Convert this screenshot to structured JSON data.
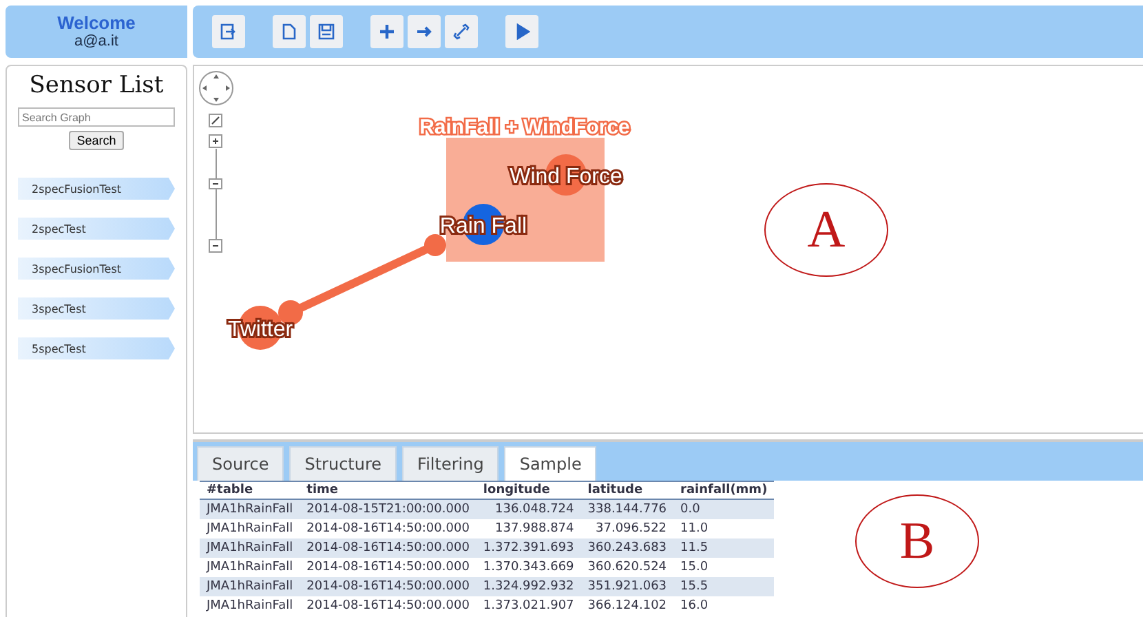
{
  "welcome": {
    "title": "Welcome",
    "user": "a@a.it"
  },
  "sidebar": {
    "title": "Sensor List",
    "search": {
      "placeholder": "Search Graph"
    },
    "search_button": "Search",
    "items": [
      {
        "label": "2specFusionTest"
      },
      {
        "label": "2specTest"
      },
      {
        "label": "3specFusionTest"
      },
      {
        "label": "3specTest"
      },
      {
        "label": "5specTest"
      }
    ]
  },
  "graph": {
    "group_label": "RainFall + WindForce",
    "nodes": [
      {
        "label": "Wind Force",
        "color": "#f26b47"
      },
      {
        "label": "Rain Fall",
        "color": "#1565e0"
      },
      {
        "label": "Twitter",
        "color": "#f26b47"
      }
    ]
  },
  "callouts": [
    "A",
    "B"
  ],
  "tabs": [
    {
      "label": "Source",
      "selected": false
    },
    {
      "label": "Structure",
      "selected": false
    },
    {
      "label": "Filtering",
      "selected": false
    },
    {
      "label": "Sample",
      "selected": true
    }
  ],
  "table": {
    "columns": [
      "#table",
      "time",
      "longitude",
      "latitude",
      "rainfall(mm)"
    ],
    "rows": [
      [
        "JMA1hRainFall",
        "2014-08-15T21:00:00.000",
        "136.048.724",
        "338.144.776",
        "0.0"
      ],
      [
        "JMA1hRainFall",
        "2014-08-16T14:50:00.000",
        "137.988.874",
        "37.096.522",
        "11.0"
      ],
      [
        "JMA1hRainFall",
        "2014-08-16T14:50:00.000",
        "1.372.391.693",
        "360.243.683",
        "11.5"
      ],
      [
        "JMA1hRainFall",
        "2014-08-16T14:50:00.000",
        "1.370.343.669",
        "360.620.524",
        "15.0"
      ],
      [
        "JMA1hRainFall",
        "2014-08-16T14:50:00.000",
        "1.324.992.932",
        "351.921.063",
        "15.5"
      ],
      [
        "JMA1hRainFall",
        "2014-08-16T14:50:00.000",
        "1.373.021.907",
        "366.124.102",
        "16.0"
      ]
    ]
  }
}
